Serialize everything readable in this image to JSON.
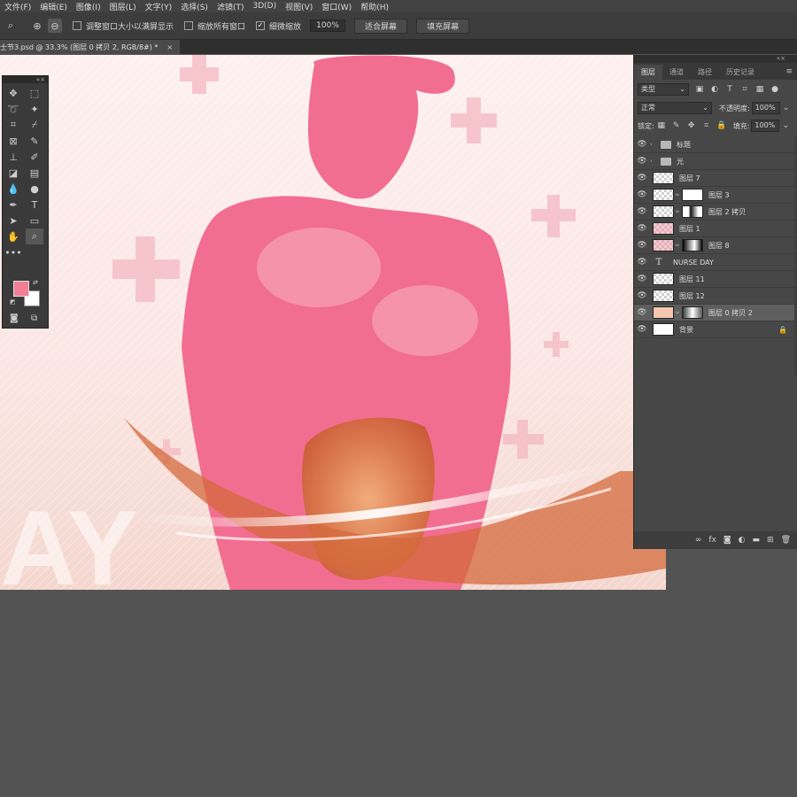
{
  "menu": [
    "文件(F)",
    "编辑(E)",
    "图像(I)",
    "图层(L)",
    "文字(Y)",
    "选择(S)",
    "滤镜(T)",
    "3D(D)",
    "视图(V)",
    "窗口(W)",
    "帮助(H)"
  ],
  "options": {
    "resize_windows": "调整窗口大小以满屏显示",
    "zoom_all": "缩放所有窗口",
    "scrubby_zoom": "细微缩放",
    "zoom_value": "100%",
    "fit_screen": "适合屏幕",
    "fill_screen": "填充屏幕"
  },
  "document_tab": "士节3.psd @ 33.3% (图层 0 拷贝 2, RGB/8#) *",
  "canvas_text": "AY",
  "toolbox": {
    "fg_color": "#f07f97",
    "bg_color": "#ffffff"
  },
  "panel": {
    "tabs": [
      "图层",
      "通道",
      "路径",
      "历史记录"
    ],
    "filter_kind": "类型",
    "blend_mode": "正常",
    "opacity_label": "不透明度:",
    "opacity_value": "100%",
    "lock_label": "锁定:",
    "fill_label": "填充:",
    "fill_value": "100%",
    "layers": [
      {
        "name": "标题",
        "kind": "group"
      },
      {
        "name": "光",
        "kind": "group"
      },
      {
        "name": "图层 7",
        "kind": "layer"
      },
      {
        "name": "图层 3",
        "kind": "masked"
      },
      {
        "name": "图层 2 拷贝",
        "kind": "masked"
      },
      {
        "name": "图层 1",
        "kind": "layer"
      },
      {
        "name": "图层 8",
        "kind": "masked"
      },
      {
        "name": "NURSE DAY",
        "kind": "text"
      },
      {
        "name": "图层 11",
        "kind": "layer"
      },
      {
        "name": "图层 12",
        "kind": "layer"
      },
      {
        "name": "图层 0 拷贝 2",
        "kind": "masked",
        "selected": true
      },
      {
        "name": "背景",
        "kind": "background"
      }
    ]
  }
}
